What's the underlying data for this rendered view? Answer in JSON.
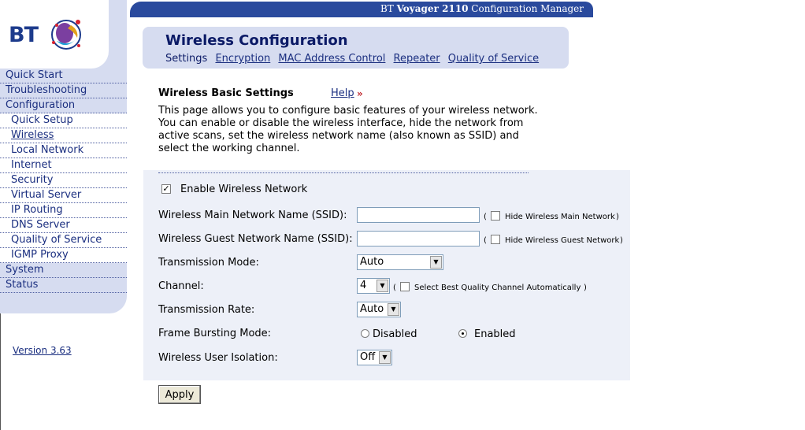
{
  "brand": {
    "logo_text": "BT",
    "colors": {
      "primary": "#2a4a9d",
      "panel": "#d6dcf0",
      "form_panel": "#edf0f8",
      "accent": "#c0282f"
    }
  },
  "topbar": {
    "prefix": "BT ",
    "product": "Voyager 2110",
    "suffix": " Configuration Manager"
  },
  "sidebar": {
    "items": [
      {
        "label": "Quick Start",
        "level": "top"
      },
      {
        "label": "Troubleshooting",
        "level": "top"
      },
      {
        "label": "Configuration",
        "level": "top"
      },
      {
        "label": "Quick Setup",
        "level": "sub"
      },
      {
        "label": "Wireless",
        "level": "sub",
        "active": true
      },
      {
        "label": "Local Network",
        "level": "sub"
      },
      {
        "label": "Internet",
        "level": "sub"
      },
      {
        "label": "Security",
        "level": "sub"
      },
      {
        "label": "Virtual Server",
        "level": "sub"
      },
      {
        "label": "IP Routing",
        "level": "sub"
      },
      {
        "label": "DNS Server",
        "level": "sub"
      },
      {
        "label": "Quality of Service",
        "level": "sub"
      },
      {
        "label": "IGMP Proxy",
        "level": "sub"
      },
      {
        "label": "System",
        "level": "top"
      },
      {
        "label": "Status",
        "level": "top"
      }
    ],
    "version": "Version 3.63"
  },
  "header": {
    "title": "Wireless Configuration",
    "tabs": [
      "Settings",
      "Encryption",
      "MAC Address Control",
      "Repeater",
      "Quality of Service"
    ]
  },
  "section": {
    "title": "Wireless Basic Settings",
    "help_label": "Help",
    "description": "This page allows you to configure basic features of your wireless network. You can enable or disable the wireless interface, hide the network from active scans, set the wireless network name (also known as SSID) and select the working channel."
  },
  "form": {
    "enable_label": "Enable Wireless Network",
    "enable_checked": true,
    "main_ssid_label": "Wireless Main Network Name (SSID):",
    "main_ssid_value": "",
    "hide_main_label": "Hide Wireless Main Network",
    "guest_ssid_label": "Wireless Guest Network Name (SSID):",
    "guest_ssid_value": "",
    "hide_guest_label": "Hide Wireless Guest Network",
    "paren_open": "(",
    "paren_close": ")",
    "mode_label": "Transmission Mode:",
    "mode_value": "Auto",
    "channel_label": "Channel:",
    "channel_value": "4",
    "best_channel_label": "Select Best Quality Channel Automatically",
    "rate_label": "Transmission Rate:",
    "rate_value": "Auto",
    "burst_label": "Frame Bursting Mode:",
    "burst_disabled": "Disabled",
    "burst_enabled": "Enabled",
    "burst_selected": "Enabled",
    "isolation_label": "Wireless User Isolation:",
    "isolation_value": "Off",
    "apply_label": "Apply"
  }
}
